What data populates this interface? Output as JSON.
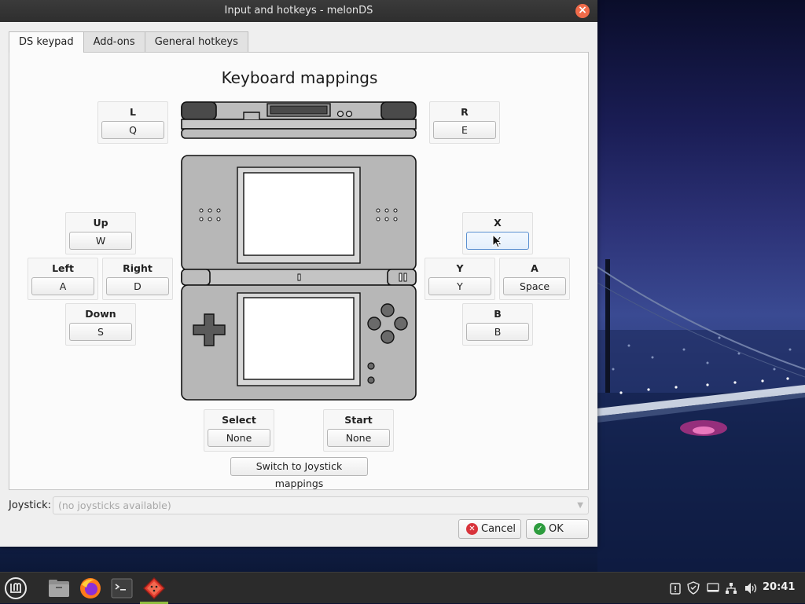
{
  "window": {
    "title": "Input and hotkeys - melonDS",
    "close_glyph": "×"
  },
  "tabs": [
    {
      "label": "DS keypad",
      "active": true
    },
    {
      "label": "Add-ons",
      "active": false
    },
    {
      "label": "General hotkeys",
      "active": false
    }
  ],
  "panel": {
    "heading": "Keyboard mappings"
  },
  "keys": {
    "l": {
      "label": "L",
      "value": "Q"
    },
    "r": {
      "label": "R",
      "value": "E"
    },
    "up": {
      "label": "Up",
      "value": "W"
    },
    "left": {
      "label": "Left",
      "value": "A"
    },
    "right": {
      "label": "Right",
      "value": "D"
    },
    "down": {
      "label": "Down",
      "value": "S"
    },
    "x": {
      "label": "X",
      "value": "X"
    },
    "y": {
      "label": "Y",
      "value": "Y"
    },
    "a": {
      "label": "A",
      "value": "Space"
    },
    "b": {
      "label": "B",
      "value": "B"
    },
    "select": {
      "label": "Select",
      "value": "None"
    },
    "start": {
      "label": "Start",
      "value": "None"
    }
  },
  "switch_button": "Switch to Joystick mappings",
  "joystick": {
    "label": "Joystick:",
    "value": "(no joysticks available)"
  },
  "buttons": {
    "cancel": "Cancel",
    "ok": "OK"
  },
  "taskbar": {
    "icons": [
      "mint-menu-icon",
      "files-icon",
      "firefox-icon",
      "terminal-icon",
      "melonds-icon"
    ],
    "tray_icons": [
      "update-icon",
      "shield-icon",
      "display-icon",
      "network-icon",
      "volume-icon"
    ],
    "clock": "20:41"
  },
  "colors": {
    "accent": "#8fbd3f",
    "close": "#f06b4a",
    "cancel": "#d8333b",
    "ok": "#2d9c3e"
  }
}
